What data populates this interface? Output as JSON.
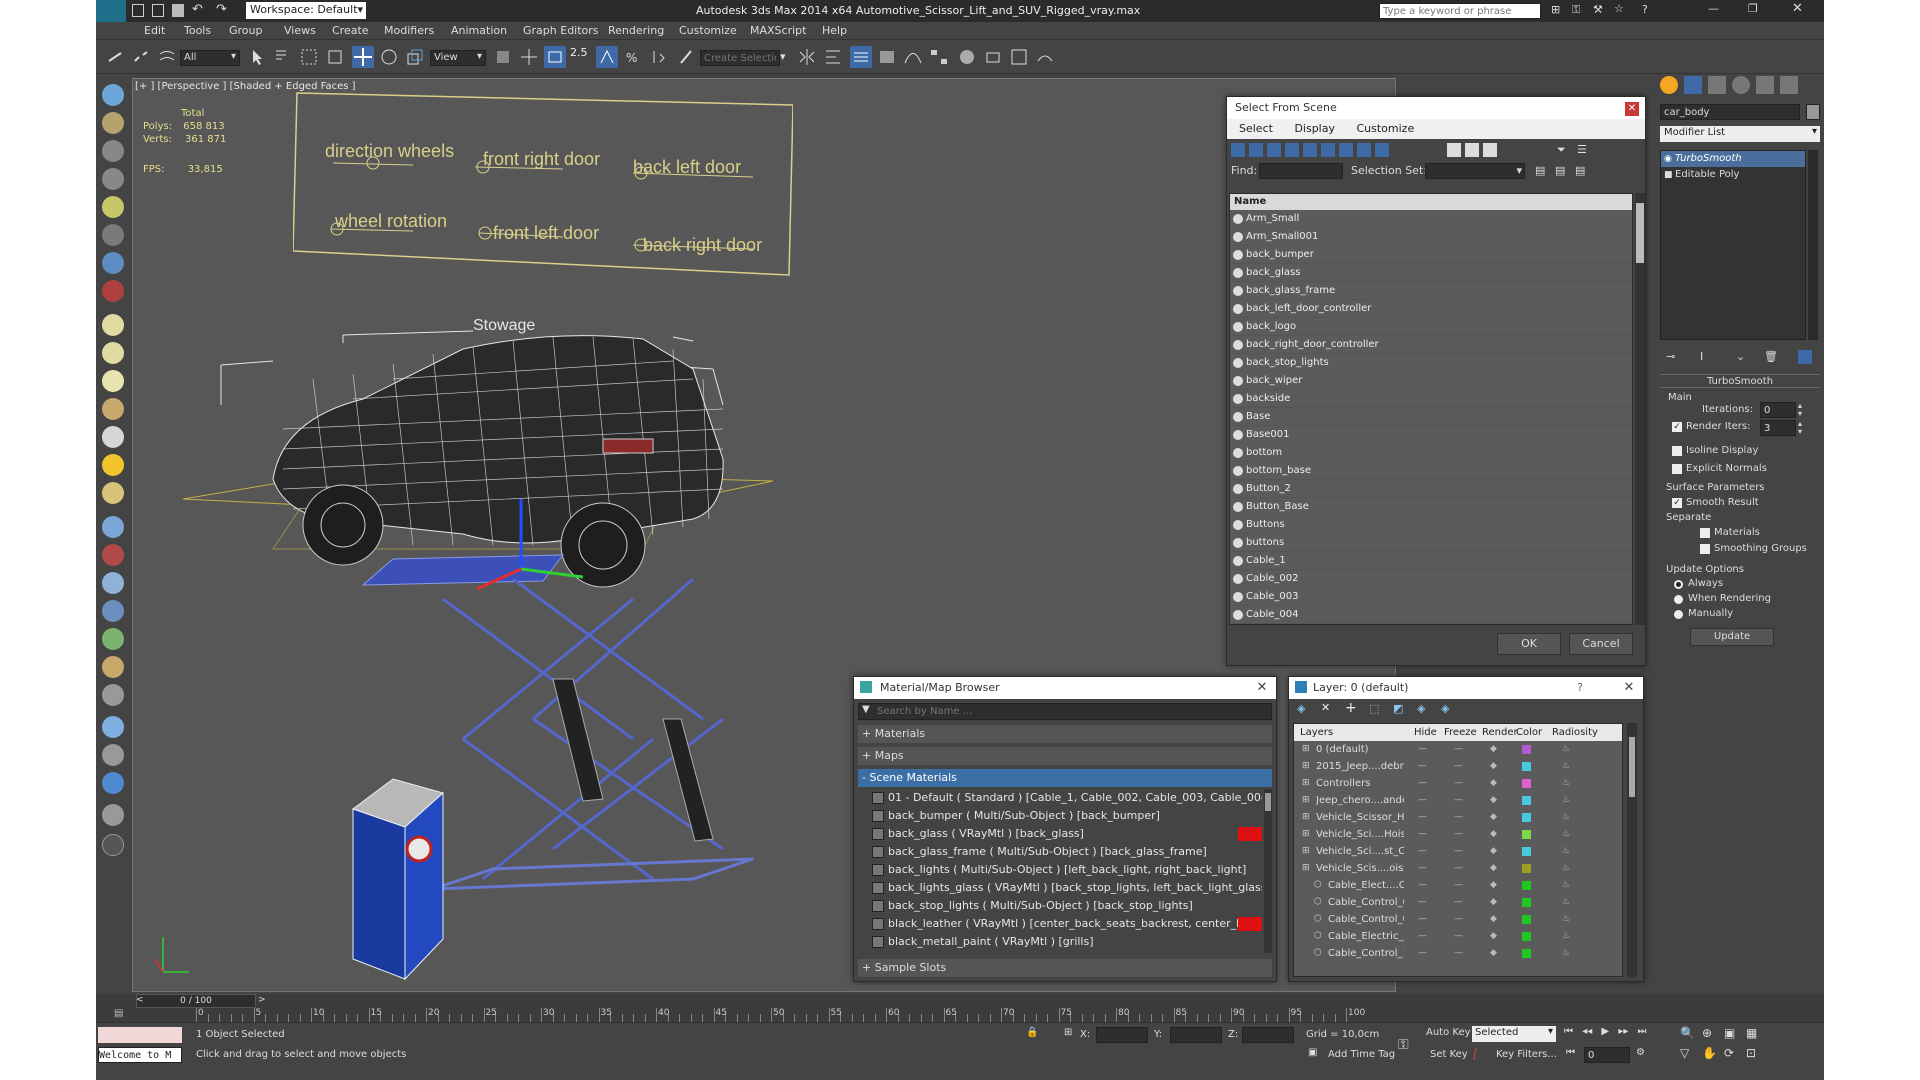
{
  "title": {
    "workspace_label": "Workspace: Default",
    "app_title": "Autodesk 3ds Max  2014 x64     Automotive_Scissor_Lift_and_SUV_Rigged_vray.max",
    "search_placeholder": "Type a keyword or phrase"
  },
  "menu": [
    "Edit",
    "Tools",
    "Group",
    "Views",
    "Create",
    "Modifiers",
    "Animation",
    "Graph Editors",
    "Rendering",
    "Customize",
    "MAXScript",
    "Help"
  ],
  "toolbar": {
    "filter_value": "All",
    "coord_value": "View",
    "snap_value": "2.5",
    "selection_set_placeholder": "Create Selection Se"
  },
  "viewport": {
    "label": "[+ ] [Perspective ] [Shaded + Edged Faces ]",
    "stats": {
      "total_label": "Total",
      "polys_label": "Polys:",
      "polys_value": "658 813",
      "verts_label": "Verts:",
      "verts_value": "361 871",
      "fps_label": "FPS:",
      "fps_value": "33,815"
    },
    "controls": [
      "direction wheels",
      "front right door",
      "back left door",
      "wheel rotation",
      "front left door",
      "back right door"
    ],
    "stowage_label": "Stowage"
  },
  "select_from_scene": {
    "title": "Select From Scene",
    "menu": [
      "Select",
      "Display",
      "Customize"
    ],
    "find_label": "Find:",
    "selection_set_label": "Selection Set:",
    "column_name": "Name",
    "items": [
      "Arm_Small",
      "Arm_Small001",
      "back_bumper",
      "back_glass",
      "back_glass_frame",
      "back_left_door_controller",
      "back_logo",
      "back_right_door_controller",
      "back_stop_lights",
      "back_wiper",
      "backside",
      "Base",
      "Base001",
      "bottom",
      "bottom_base",
      "Button_2",
      "Button_Base",
      "Buttons",
      "buttons",
      "Cable_1",
      "Cable_002",
      "Cable_003",
      "Cable_004"
    ],
    "ok_label": "OK",
    "cancel_label": "Cancel"
  },
  "material_browser": {
    "title": "Material/Map Browser",
    "search_placeholder": "Search by Name ...",
    "materials_label": "+ Materials",
    "maps_label": "+ Maps",
    "scene_materials_label": "- Scene Materials",
    "rows": [
      "01 - Default  ( Standard )  [Cable_1, Cable_002, Cable_003, Cable_004, Cable_0...",
      "back_bumper  ( Multi/Sub-Object )  [back_bumper]",
      "back_glass  ( VRayMtl )  [back_glass]",
      "back_glass_frame  ( Multi/Sub-Object )  [back_glass_frame]",
      "back_lights  ( Multi/Sub-Object )  [left_back_light, right_back_light]",
      "back_lights_glass  ( VRayMtl )  [back_stop_lights, left_back_light_glass, right_ba...",
      "back_stop_lights  ( Multi/Sub-Object )  [back_stop_lights]",
      "black_leather  ( VRayMtl )  [center_back_seats_backrest, center_back_seats_bott...",
      "black_metall_paint  ( VRayMtl )  [grills]"
    ],
    "sample_slots_label": "+ Sample Slots"
  },
  "layer_explorer": {
    "title": "Layer: 0 (default)",
    "help": "?",
    "columns": [
      "Layers",
      "Hide",
      "Freeze",
      "Render",
      "Color",
      "Radiosity"
    ],
    "rows": [
      {
        "name": "0 (default)",
        "color": "#b05cd0"
      },
      {
        "name": "2015_Jeep....debr",
        "color": "#49c9e0"
      },
      {
        "name": "Controllers",
        "color": "#e060d0"
      },
      {
        "name": "Jeep_chero....andec",
        "color": "#49c9e0"
      },
      {
        "name": "Vehicle_Scissor_Hoi",
        "color": "#49c9e0"
      },
      {
        "name": "Vehicle_Sci....Hoist_I",
        "color": "#7cd848"
      },
      {
        "name": "Vehicle_Sci....st_Cor",
        "color": "#49c9e0"
      },
      {
        "name": "Vehicle_Scis....oist_I",
        "color": "#9aa020"
      },
      {
        "name": "Cable_Elect....Cc",
        "color": "#1ec81e"
      },
      {
        "name": "Cable_Control_0",
        "color": "#1ec81e"
      },
      {
        "name": "Cable_Control_0",
        "color": "#1ec81e"
      },
      {
        "name": "Cable_Electric_C",
        "color": "#1ec81e"
      },
      {
        "name": "Cable_Control_1",
        "color": "#1ec81e"
      }
    ]
  },
  "command_panel": {
    "object_name": "car_body",
    "modifier_list_label": "Modifier List",
    "stack": [
      "TurboSmooth",
      "Editable Poly"
    ],
    "rollout_title": "TurboSmooth",
    "main_label": "Main",
    "iterations_label": "Iterations:",
    "iterations_value": "0",
    "render_iters_label": "Render Iters:",
    "render_iters_value": "3",
    "isoline_label": "Isoline Display",
    "explicit_normals_label": "Explicit Normals",
    "surface_params_label": "Surface Parameters",
    "smooth_result_label": "Smooth Result",
    "separate_label": "Separate",
    "materials_label": "Materials",
    "smoothing_groups_label": "Smoothing Groups",
    "update_options_label": "Update Options",
    "always_label": "Always",
    "when_rendering_label": "When Rendering",
    "manually_label": "Manually",
    "update_button": "Update"
  },
  "timeline": {
    "frame_label": "0 / 100",
    "ticks": [
      "0",
      "5",
      "10",
      "15",
      "20",
      "25",
      "30",
      "35",
      "40",
      "45",
      "50",
      "55",
      "60",
      "65",
      "70",
      "75",
      "80",
      "85",
      "90",
      "95",
      "100"
    ]
  },
  "status": {
    "welcome": "Welcome to M",
    "selected_text": "1 Object Selected",
    "prompt": "Click and drag to select and move objects",
    "x_label": "X:",
    "y_label": "Y:",
    "z_label": "Z:",
    "grid": "Grid = 10,0cm",
    "add_time_tag": "Add Time Tag",
    "auto_key": "Auto Key",
    "set_key": "Set Key",
    "selected_dropdown": "Selected",
    "key_filters": "Key Filters...",
    "frame_value": "0"
  }
}
